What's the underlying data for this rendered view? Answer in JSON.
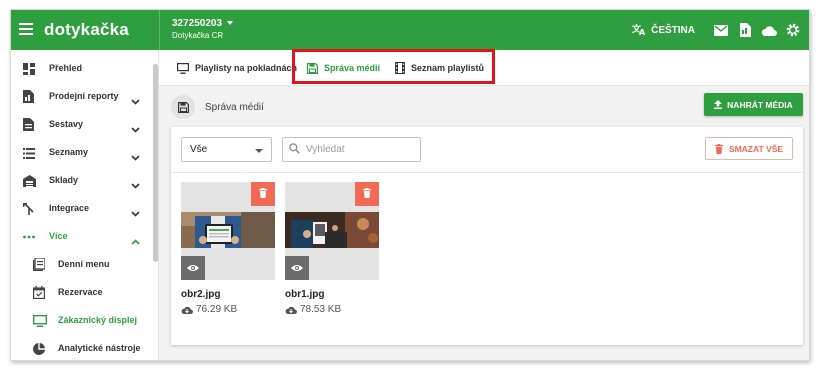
{
  "topbar": {
    "brand": "dotykačka",
    "account_id": "327250203",
    "account_name": "Dotykačka CR",
    "language": "ČEŠTINA",
    "icons": [
      "translate-icon",
      "mail-icon",
      "document-icon",
      "cloud-icon",
      "settings-icon"
    ]
  },
  "sidebar": {
    "items": [
      {
        "label": "Přehled",
        "icon": "dashboard-icon"
      },
      {
        "label": "Prodejní reporty",
        "icon": "reports-icon"
      },
      {
        "label": "Sestavy",
        "icon": "document-icon"
      },
      {
        "label": "Seznamy",
        "icon": "list-icon"
      },
      {
        "label": "Sklady",
        "icon": "warehouse-icon"
      },
      {
        "label": "Integrace",
        "icon": "integration-icon"
      },
      {
        "label": "Více",
        "icon": "more-icon"
      },
      {
        "label": "Denní menu",
        "icon": "menu-icon"
      },
      {
        "label": "Rezervace",
        "icon": "calendar-icon"
      },
      {
        "label": "Zákaznický displej",
        "icon": "monitor-icon"
      },
      {
        "label": "Analytické nástroje",
        "icon": "pie-chart-icon"
      }
    ]
  },
  "tabs": [
    {
      "label": "Playlisty na pokladnách",
      "icon": "monitor-icon"
    },
    {
      "label": "Správa médií",
      "icon": "save-icon"
    },
    {
      "label": "Seznam playlistů",
      "icon": "film-icon"
    }
  ],
  "content": {
    "title": "Správa médií",
    "upload_label": "NAHRÁT MÉDIA",
    "filter_value": "Vše",
    "search_placeholder": "Vyhledat",
    "delete_all_label": "SMAZAT VŠE"
  },
  "media": [
    {
      "name": "obr2.jpg",
      "size": "76.29 KB"
    },
    {
      "name": "obr1.jpg",
      "size": "78.53 KB"
    }
  ],
  "colors": {
    "brand_green": "#2e9e3e",
    "delete_red": "#f26a55",
    "highlight_red": "#e0141b"
  }
}
